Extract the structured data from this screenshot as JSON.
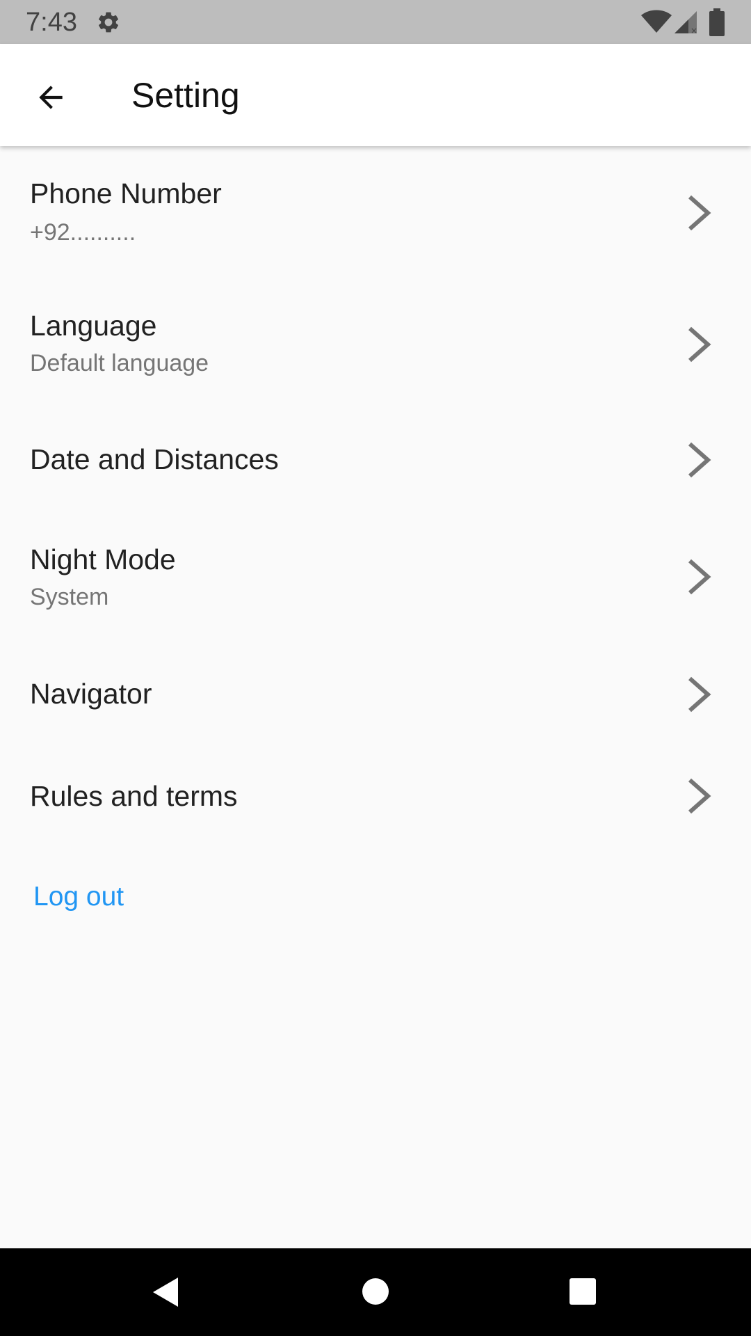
{
  "status_bar": {
    "time": "7:43",
    "icons": [
      "settings-icon",
      "wifi-icon",
      "signal-icon",
      "battery-icon"
    ]
  },
  "app_bar": {
    "title": "Setting",
    "back_icon": "arrow-back-icon"
  },
  "settings": {
    "items": [
      {
        "title": "Phone Number",
        "subtitle": "+92.........."
      },
      {
        "title": "Language",
        "subtitle": "Default language"
      },
      {
        "title": "Date and Distances"
      },
      {
        "title": "Night Mode",
        "subtitle": "System"
      },
      {
        "title": "Navigator"
      },
      {
        "title": "Rules and terms"
      }
    ],
    "chevron_icon": "chevron-right-icon"
  },
  "logout": {
    "label": "Log out"
  },
  "colors": {
    "accent": "#2196f3",
    "status_bar": "#bdbdbd",
    "background": "#fafafa",
    "nav_bar": "#000000"
  },
  "nav_bar": {
    "icons": [
      "back-triangle-icon",
      "home-circle-icon",
      "recents-square-icon"
    ]
  }
}
